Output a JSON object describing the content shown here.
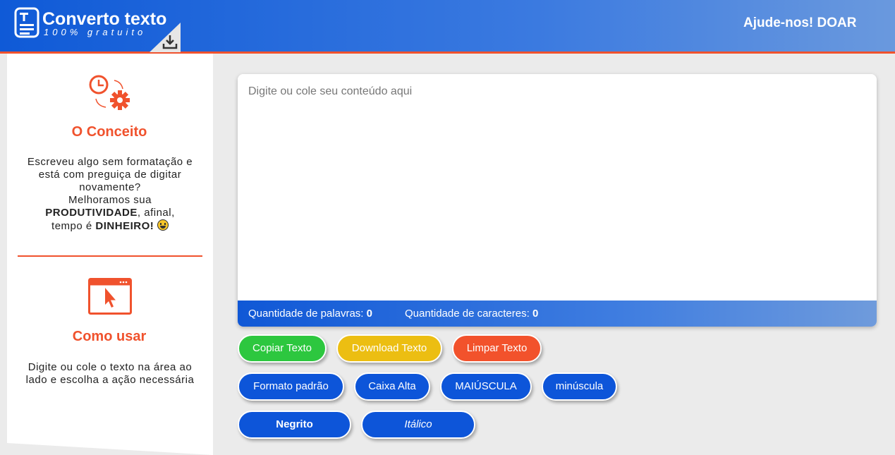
{
  "header": {
    "logo_title": "Converto texto",
    "logo_subtitle": "100% gratuito",
    "donate_label": "Ajude-nos! DOAR",
    "colors": {
      "primary": "#0f5ad7",
      "accent": "#f0522d"
    }
  },
  "sidebar": {
    "concept": {
      "icon": "clock-gear-icon",
      "title": "O Conceito",
      "line1": "Escreveu algo sem formatação e está com preguiça de digitar novamente?",
      "line2": "Melhoramos sua",
      "bold1": "PRODUTIVIDADE",
      "line3": ", afinal,",
      "line4": "tempo é",
      "bold2": "DINHEIRO!",
      "emoji": "grinning-face-icon"
    },
    "usage": {
      "icon": "browser-cursor-icon",
      "title": "Como usar",
      "text": "Digite ou cole o texto na área ao lado e escolha a ação necessária"
    }
  },
  "editor": {
    "placeholder": "Digite ou cole seu conteúdo aqui",
    "value": "",
    "words_label": "Quantidade de palavras:",
    "words_value": "0",
    "chars_label": "Quantidade de caracteres:",
    "chars_value": "0"
  },
  "actions": {
    "copy": "Copiar Texto",
    "download": "Download Texto",
    "clear": "Limpar Texto",
    "default_format": "Formato padrão",
    "title_case": "Caixa Alta",
    "uppercase": "MAIÚSCULA",
    "lowercase": "minúscula",
    "bold": "Negrito",
    "italic": "Itálico"
  }
}
